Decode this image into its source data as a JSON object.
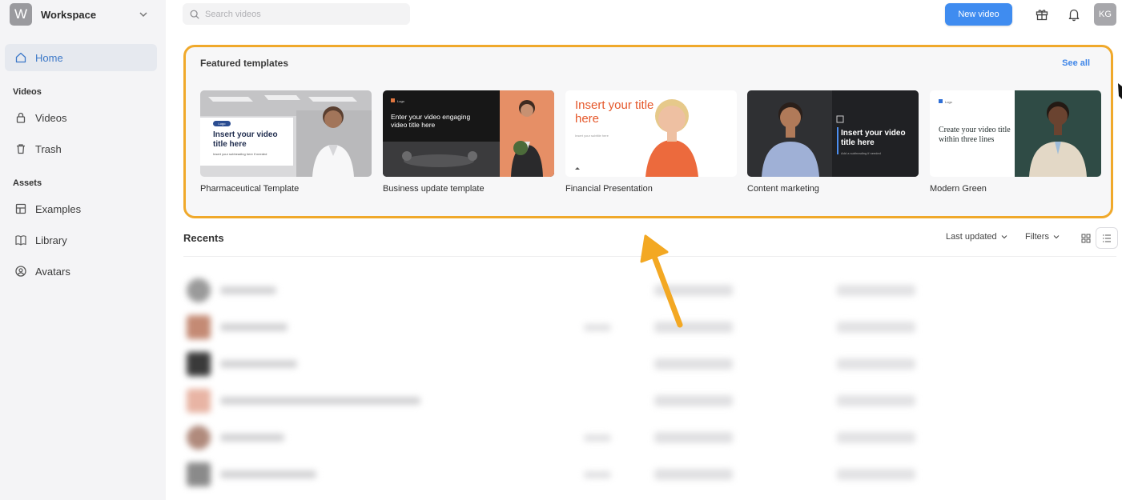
{
  "workspace": {
    "initial": "W",
    "name": "Workspace"
  },
  "sidebar": {
    "home": "Home",
    "videos_section": "Videos",
    "videos": "Videos",
    "trash": "Trash",
    "assets_section": "Assets",
    "examples": "Examples",
    "library": "Library",
    "avatars": "Avatars"
  },
  "topbar": {
    "search_placeholder": "Search videos",
    "new_video": "New video",
    "avatar_initials": "KG"
  },
  "featured": {
    "title": "Featured templates",
    "see_all": "See all",
    "cards": [
      {
        "label": "Pharmaceutical Template",
        "headline": "Insert your video title here",
        "subtitle": "Insert your subheading here if needed",
        "badge": "Logo"
      },
      {
        "label": "Business update template",
        "headline": "Enter your video engaging video title here",
        "badge": "Logo"
      },
      {
        "label": "Financial Presentation",
        "headline": "Insert your title here",
        "subtitle": "Insert your subtitle here"
      },
      {
        "label": "Content marketing",
        "headline": "Insert your video title here",
        "subtitle": "Add a subheading if needed"
      },
      {
        "label": "Modern Green",
        "headline": "Create your video title within three lines",
        "badge": "Logo"
      }
    ]
  },
  "recents": {
    "title": "Recents",
    "sort_label": "Last updated",
    "filters_label": "Filters"
  },
  "colors": {
    "accent": "#3f8cf0",
    "highlight": "#f0a92b",
    "sidebar_bg": "#f4f4f6"
  }
}
